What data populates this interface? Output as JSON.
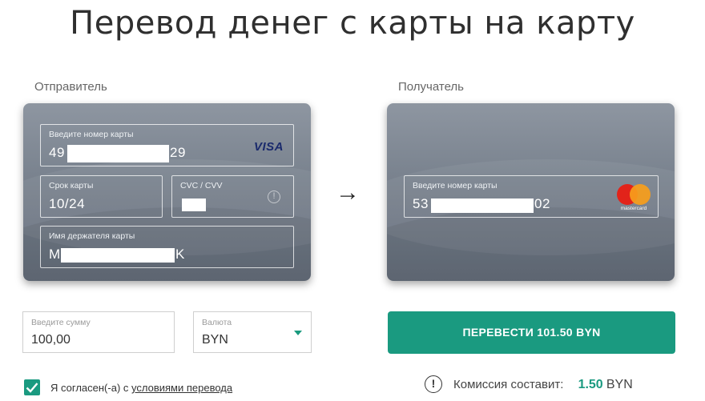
{
  "page": {
    "title": "Перевод денег с карты на карту"
  },
  "sender": {
    "label": "Отправитель",
    "card_number": {
      "label": "Введите номер карты",
      "prefix": "49",
      "suffix": "29"
    },
    "expiry": {
      "label": "Срок карты",
      "value": "10/24"
    },
    "cvc": {
      "label": "CVC / CVV",
      "info_icon": "info-icon"
    },
    "holder": {
      "label": "Имя держателя карты",
      "prefix": "M",
      "suffix": "K"
    },
    "brand": "VISA"
  },
  "receiver": {
    "label": "Получатель",
    "card_number": {
      "label": "Введите номер карты",
      "prefix": "53",
      "suffix": "02"
    },
    "brand": "mastercard"
  },
  "amount": {
    "label": "Введите сумму",
    "value": "100,00"
  },
  "currency": {
    "label": "Валюта",
    "value": "BYN"
  },
  "submit": {
    "label": "ПЕРЕВЕСТИ 101.50 BYN"
  },
  "agreement": {
    "text": "Я согласен(-а) с",
    "link": "условиями перевода",
    "checked": true
  },
  "commission": {
    "label": "Комиссия составит:",
    "amount": "1.50",
    "currency": "BYN"
  },
  "colors": {
    "accent": "#1a9a80",
    "card": "#7a838f"
  }
}
